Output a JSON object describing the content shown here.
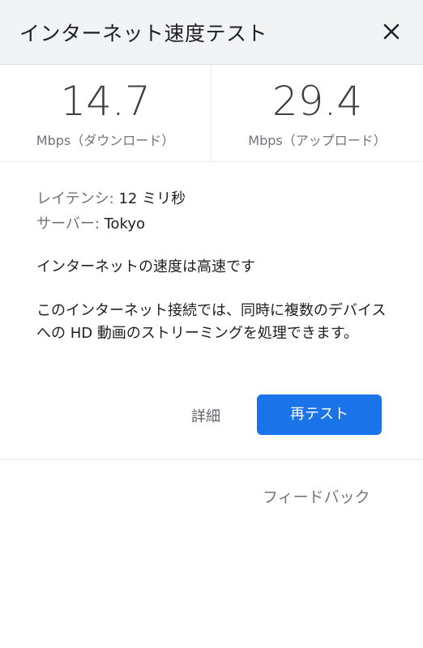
{
  "header": {
    "title": "インターネット速度テスト",
    "close_icon": "close-icon"
  },
  "speeds": {
    "download": {
      "value": "14.7",
      "label": "Mbps（ダウンロード）"
    },
    "upload": {
      "value": "29.4",
      "label": "Mbps（アップロード）"
    }
  },
  "details": {
    "latency_key": "レイテンシ: ",
    "latency_value": "12 ミリ秒",
    "server_key": "サーバー: ",
    "server_value": "Tokyo",
    "summary": "インターネットの速度は高速です",
    "description": "このインターネット接続では、同時に複数のデバイスへの HD 動画のストリーミングを処理できます。"
  },
  "actions": {
    "details_label": "詳細",
    "retest_label": "再テスト"
  },
  "footer": {
    "feedback_label": "フィードバック"
  },
  "colors": {
    "accent": "#1a73e8",
    "header_bg": "#f1f3f4"
  }
}
